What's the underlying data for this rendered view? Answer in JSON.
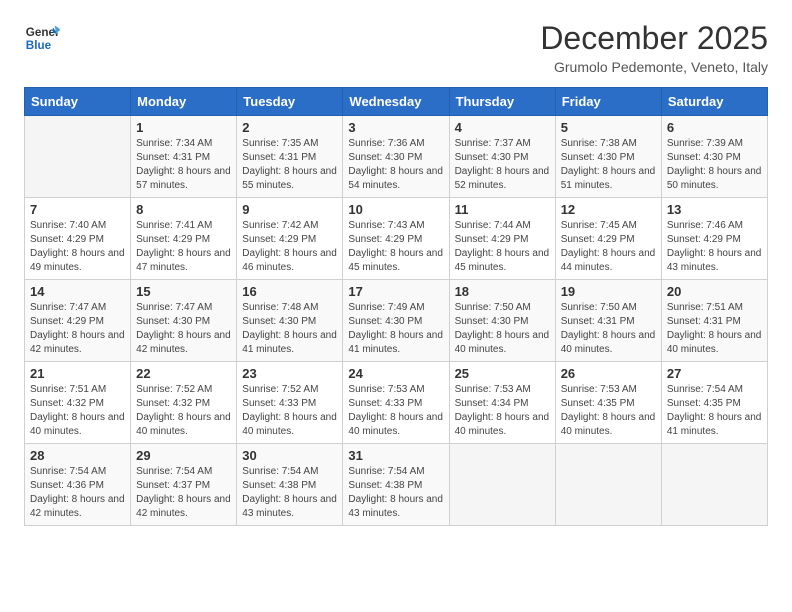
{
  "logo": {
    "line1": "General",
    "line2": "Blue"
  },
  "title": "December 2025",
  "subtitle": "Grumolo Pedemonte, Veneto, Italy",
  "weekdays": [
    "Sunday",
    "Monday",
    "Tuesday",
    "Wednesday",
    "Thursday",
    "Friday",
    "Saturday"
  ],
  "weeks": [
    [
      {
        "day": "",
        "sunrise": "",
        "sunset": "",
        "daylight": ""
      },
      {
        "day": "1",
        "sunrise": "Sunrise: 7:34 AM",
        "sunset": "Sunset: 4:31 PM",
        "daylight": "Daylight: 8 hours and 57 minutes."
      },
      {
        "day": "2",
        "sunrise": "Sunrise: 7:35 AM",
        "sunset": "Sunset: 4:31 PM",
        "daylight": "Daylight: 8 hours and 55 minutes."
      },
      {
        "day": "3",
        "sunrise": "Sunrise: 7:36 AM",
        "sunset": "Sunset: 4:30 PM",
        "daylight": "Daylight: 8 hours and 54 minutes."
      },
      {
        "day": "4",
        "sunrise": "Sunrise: 7:37 AM",
        "sunset": "Sunset: 4:30 PM",
        "daylight": "Daylight: 8 hours and 52 minutes."
      },
      {
        "day": "5",
        "sunrise": "Sunrise: 7:38 AM",
        "sunset": "Sunset: 4:30 PM",
        "daylight": "Daylight: 8 hours and 51 minutes."
      },
      {
        "day": "6",
        "sunrise": "Sunrise: 7:39 AM",
        "sunset": "Sunset: 4:30 PM",
        "daylight": "Daylight: 8 hours and 50 minutes."
      }
    ],
    [
      {
        "day": "7",
        "sunrise": "Sunrise: 7:40 AM",
        "sunset": "Sunset: 4:29 PM",
        "daylight": "Daylight: 8 hours and 49 minutes."
      },
      {
        "day": "8",
        "sunrise": "Sunrise: 7:41 AM",
        "sunset": "Sunset: 4:29 PM",
        "daylight": "Daylight: 8 hours and 47 minutes."
      },
      {
        "day": "9",
        "sunrise": "Sunrise: 7:42 AM",
        "sunset": "Sunset: 4:29 PM",
        "daylight": "Daylight: 8 hours and 46 minutes."
      },
      {
        "day": "10",
        "sunrise": "Sunrise: 7:43 AM",
        "sunset": "Sunset: 4:29 PM",
        "daylight": "Daylight: 8 hours and 45 minutes."
      },
      {
        "day": "11",
        "sunrise": "Sunrise: 7:44 AM",
        "sunset": "Sunset: 4:29 PM",
        "daylight": "Daylight: 8 hours and 45 minutes."
      },
      {
        "day": "12",
        "sunrise": "Sunrise: 7:45 AM",
        "sunset": "Sunset: 4:29 PM",
        "daylight": "Daylight: 8 hours and 44 minutes."
      },
      {
        "day": "13",
        "sunrise": "Sunrise: 7:46 AM",
        "sunset": "Sunset: 4:29 PM",
        "daylight": "Daylight: 8 hours and 43 minutes."
      }
    ],
    [
      {
        "day": "14",
        "sunrise": "Sunrise: 7:47 AM",
        "sunset": "Sunset: 4:29 PM",
        "daylight": "Daylight: 8 hours and 42 minutes."
      },
      {
        "day": "15",
        "sunrise": "Sunrise: 7:47 AM",
        "sunset": "Sunset: 4:30 PM",
        "daylight": "Daylight: 8 hours and 42 minutes."
      },
      {
        "day": "16",
        "sunrise": "Sunrise: 7:48 AM",
        "sunset": "Sunset: 4:30 PM",
        "daylight": "Daylight: 8 hours and 41 minutes."
      },
      {
        "day": "17",
        "sunrise": "Sunrise: 7:49 AM",
        "sunset": "Sunset: 4:30 PM",
        "daylight": "Daylight: 8 hours and 41 minutes."
      },
      {
        "day": "18",
        "sunrise": "Sunrise: 7:50 AM",
        "sunset": "Sunset: 4:30 PM",
        "daylight": "Daylight: 8 hours and 40 minutes."
      },
      {
        "day": "19",
        "sunrise": "Sunrise: 7:50 AM",
        "sunset": "Sunset: 4:31 PM",
        "daylight": "Daylight: 8 hours and 40 minutes."
      },
      {
        "day": "20",
        "sunrise": "Sunrise: 7:51 AM",
        "sunset": "Sunset: 4:31 PM",
        "daylight": "Daylight: 8 hours and 40 minutes."
      }
    ],
    [
      {
        "day": "21",
        "sunrise": "Sunrise: 7:51 AM",
        "sunset": "Sunset: 4:32 PM",
        "daylight": "Daylight: 8 hours and 40 minutes."
      },
      {
        "day": "22",
        "sunrise": "Sunrise: 7:52 AM",
        "sunset": "Sunset: 4:32 PM",
        "daylight": "Daylight: 8 hours and 40 minutes."
      },
      {
        "day": "23",
        "sunrise": "Sunrise: 7:52 AM",
        "sunset": "Sunset: 4:33 PM",
        "daylight": "Daylight: 8 hours and 40 minutes."
      },
      {
        "day": "24",
        "sunrise": "Sunrise: 7:53 AM",
        "sunset": "Sunset: 4:33 PM",
        "daylight": "Daylight: 8 hours and 40 minutes."
      },
      {
        "day": "25",
        "sunrise": "Sunrise: 7:53 AM",
        "sunset": "Sunset: 4:34 PM",
        "daylight": "Daylight: 8 hours and 40 minutes."
      },
      {
        "day": "26",
        "sunrise": "Sunrise: 7:53 AM",
        "sunset": "Sunset: 4:35 PM",
        "daylight": "Daylight: 8 hours and 40 minutes."
      },
      {
        "day": "27",
        "sunrise": "Sunrise: 7:54 AM",
        "sunset": "Sunset: 4:35 PM",
        "daylight": "Daylight: 8 hours and 41 minutes."
      }
    ],
    [
      {
        "day": "28",
        "sunrise": "Sunrise: 7:54 AM",
        "sunset": "Sunset: 4:36 PM",
        "daylight": "Daylight: 8 hours and 42 minutes."
      },
      {
        "day": "29",
        "sunrise": "Sunrise: 7:54 AM",
        "sunset": "Sunset: 4:37 PM",
        "daylight": "Daylight: 8 hours and 42 minutes."
      },
      {
        "day": "30",
        "sunrise": "Sunrise: 7:54 AM",
        "sunset": "Sunset: 4:38 PM",
        "daylight": "Daylight: 8 hours and 43 minutes."
      },
      {
        "day": "31",
        "sunrise": "Sunrise: 7:54 AM",
        "sunset": "Sunset: 4:38 PM",
        "daylight": "Daylight: 8 hours and 43 minutes."
      },
      {
        "day": "",
        "sunrise": "",
        "sunset": "",
        "daylight": ""
      },
      {
        "day": "",
        "sunrise": "",
        "sunset": "",
        "daylight": ""
      },
      {
        "day": "",
        "sunrise": "",
        "sunset": "",
        "daylight": ""
      }
    ]
  ]
}
